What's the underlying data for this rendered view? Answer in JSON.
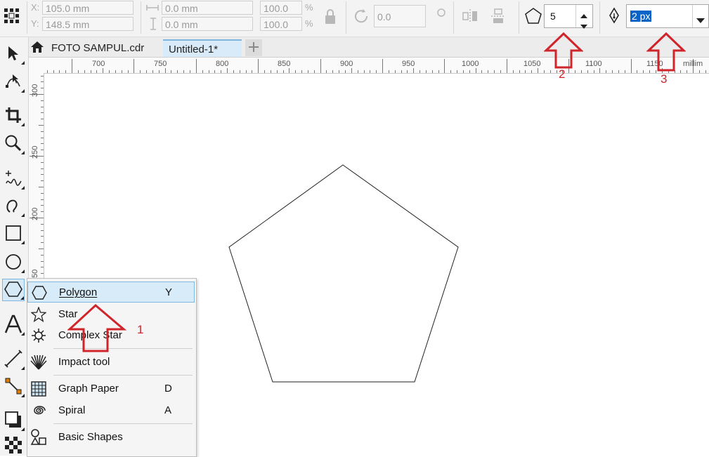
{
  "propbar": {
    "x_label": "X:",
    "x_value": "105.0 mm",
    "y_label": "Y:",
    "y_value": "148.5 mm",
    "w_value": "0.0 mm",
    "h_value": "0.0 mm",
    "scale_x": "100.0",
    "scale_y": "100.0",
    "percent": "%",
    "rotation": "0.0",
    "sides_value": "5",
    "outline_width": "2 px"
  },
  "tabs": [
    {
      "label": "FOTO SAMPUL.cdr"
    },
    {
      "label": "Untitled-1*"
    }
  ],
  "ruler": {
    "h_labels": [
      "700",
      "750",
      "800",
      "850",
      "900",
      "950",
      "1000",
      "1050",
      "1100",
      "1150"
    ],
    "h_unit": "millim",
    "v_labels": [
      "300",
      "250",
      "200",
      "150"
    ]
  },
  "flyout": {
    "items": [
      {
        "label": "Polygon",
        "shortcut": "Y",
        "icon": "polygon-icon"
      },
      {
        "label": "Star",
        "shortcut": "",
        "icon": "star-icon"
      },
      {
        "label": "Complex Star",
        "shortcut": "",
        "icon": "complex-star-icon"
      },
      {
        "label": "Impact tool",
        "shortcut": "",
        "icon": "impact-icon"
      },
      {
        "label": "Graph Paper",
        "shortcut": "D",
        "icon": "graph-paper-icon"
      },
      {
        "label": "Spiral",
        "shortcut": "A",
        "icon": "spiral-icon"
      },
      {
        "label": "Basic Shapes",
        "shortcut": "",
        "icon": "basic-shapes-icon"
      }
    ]
  },
  "annotations": {
    "n1": "1",
    "n2": "2",
    "n3": "3"
  },
  "colors": {
    "annotation": "#d0242b",
    "highlight": "#d7ebf8",
    "selection": "#0a64c8"
  }
}
